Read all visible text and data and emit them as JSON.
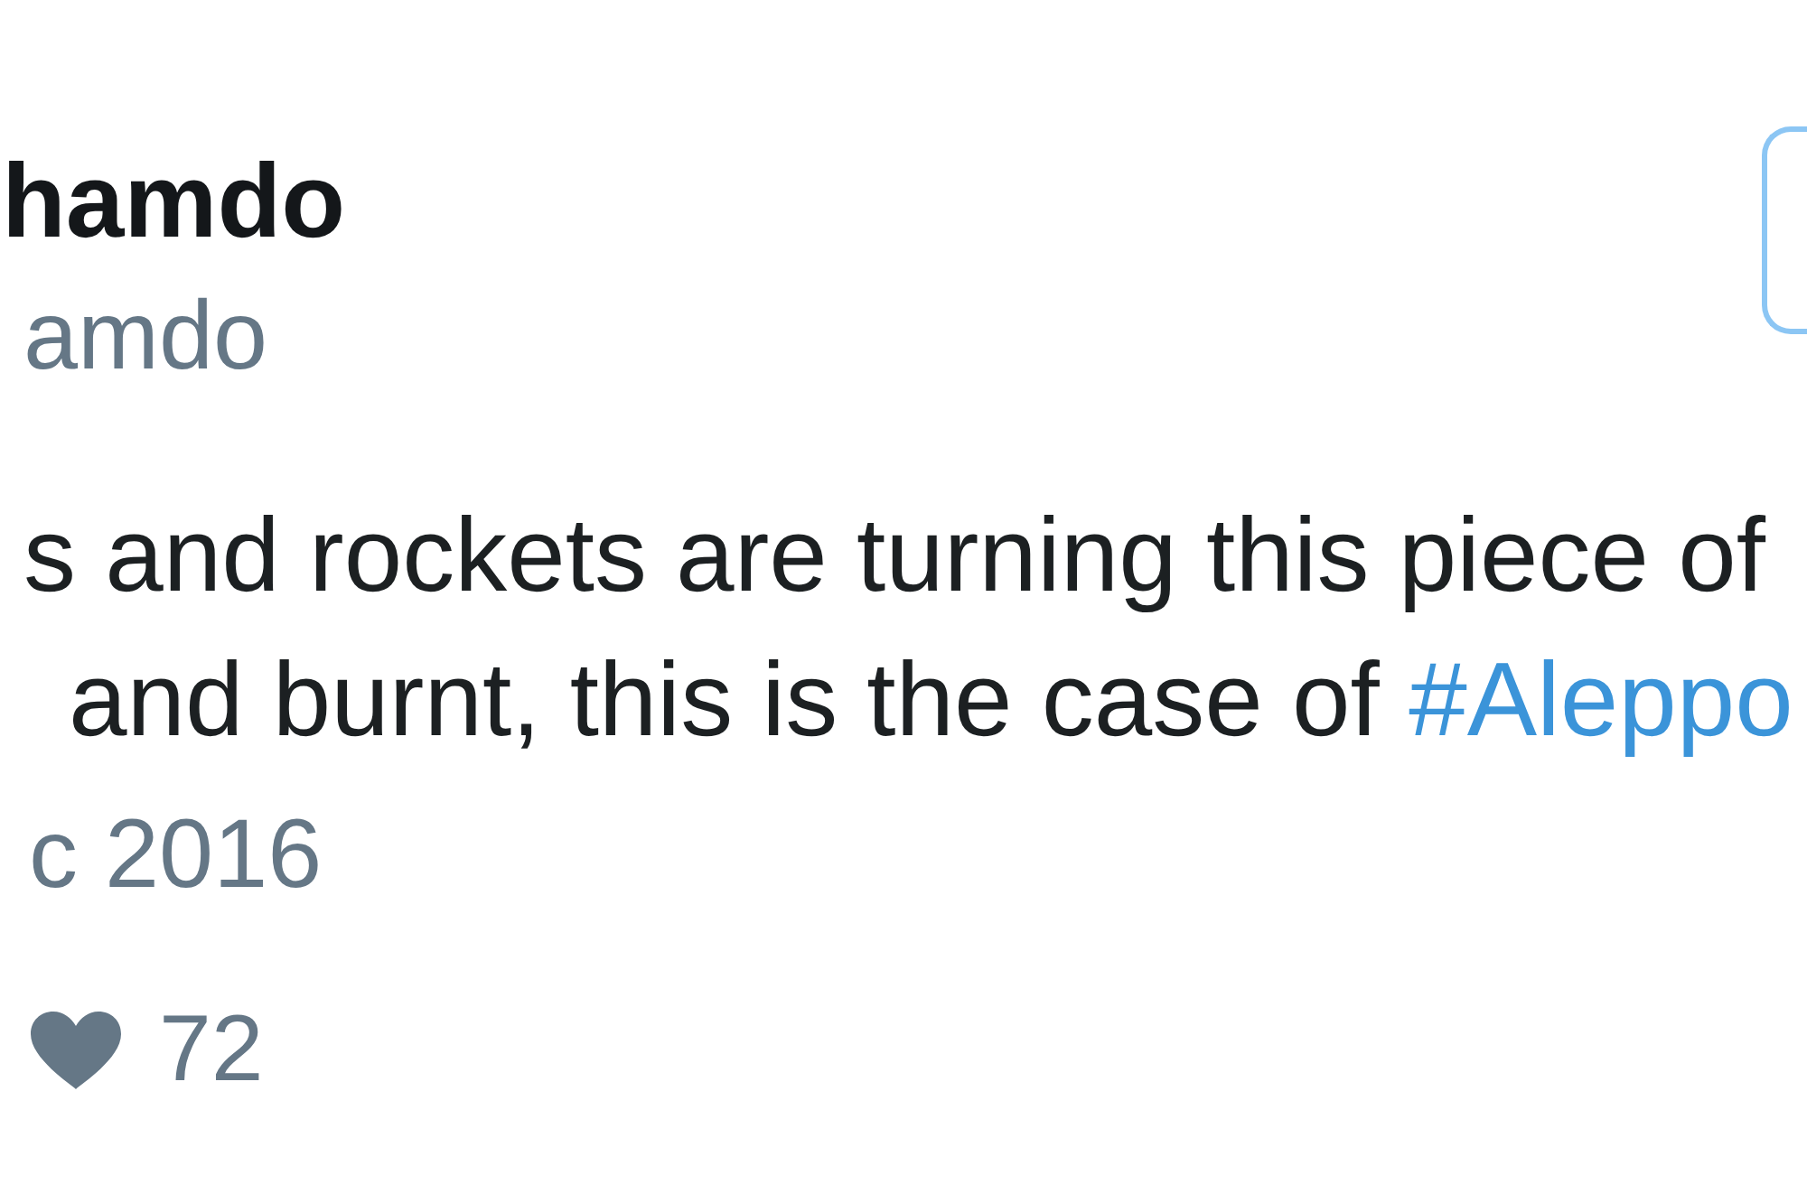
{
  "tweet": {
    "author": {
      "name": "hamdo",
      "handle": "amdo"
    },
    "lines": [
      {
        "text": "s and rockets are turning this piece of"
      },
      {
        "text": "and burnt, this is the case of",
        "hashtag": "#Aleppo"
      }
    ],
    "date": "c 2016",
    "likes": "72"
  }
}
